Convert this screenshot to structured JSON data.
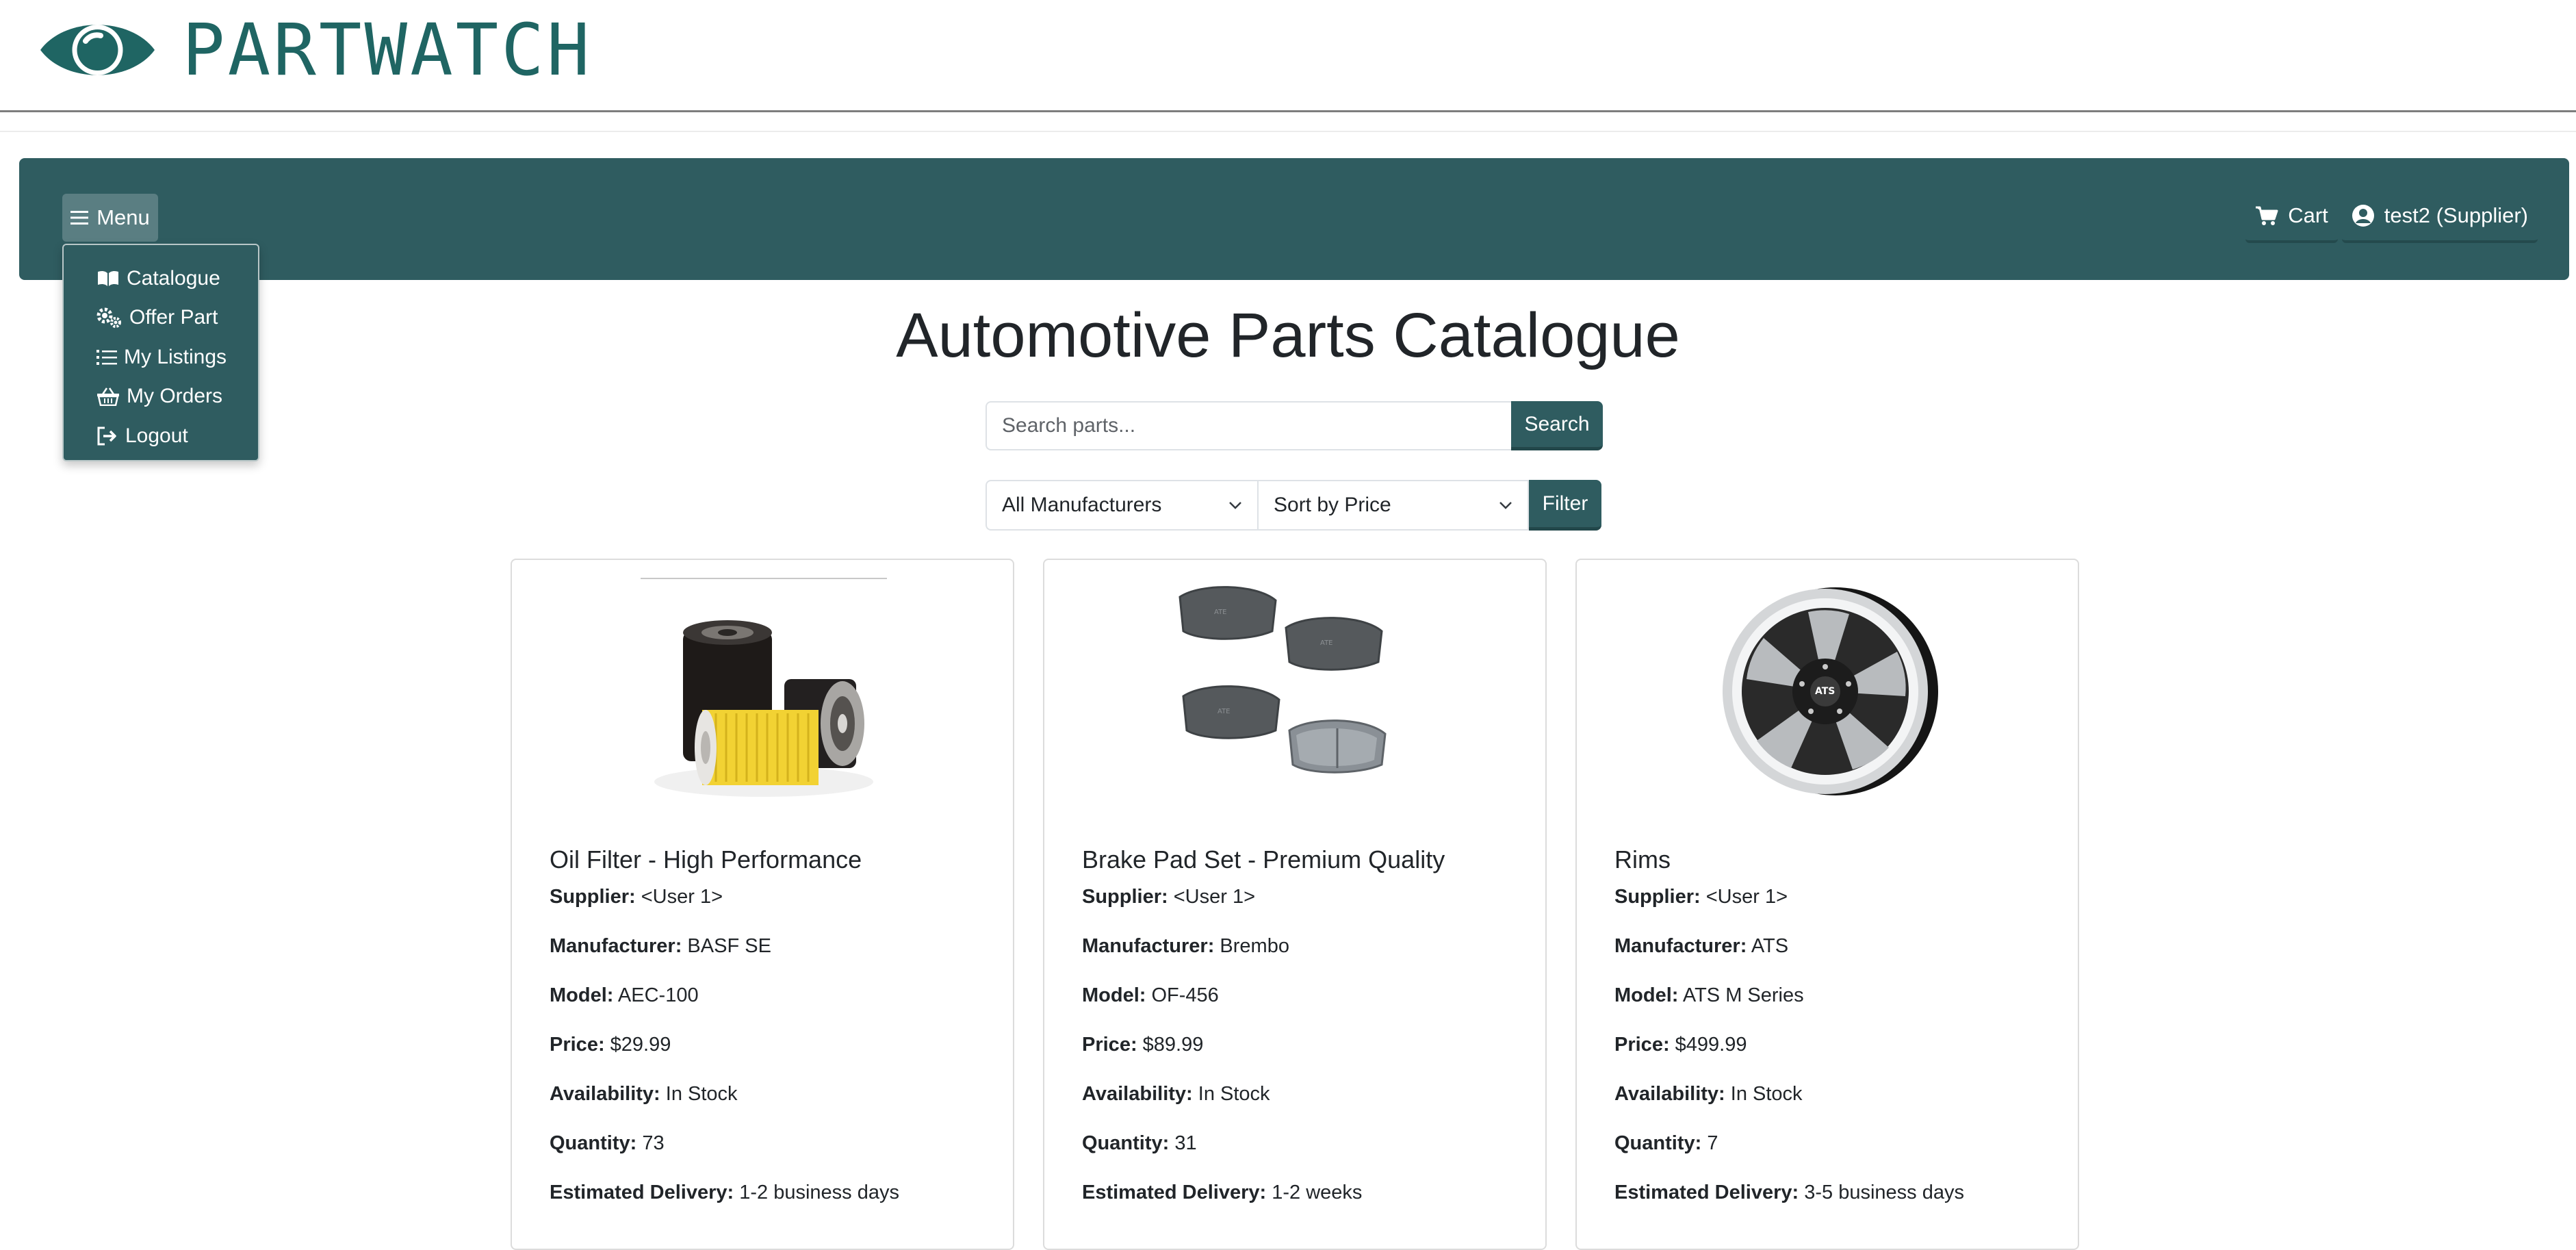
{
  "brand": {
    "name": "PARTWATCH",
    "logo_icon": "eye-icon"
  },
  "navbar": {
    "menu_label": "Menu",
    "cart_label": "Cart",
    "user_label": "test2 (Supplier)"
  },
  "menu": {
    "items": [
      {
        "label": "Catalogue",
        "icon": "book-icon"
      },
      {
        "label": "Offer Part",
        "icon": "gears-icon"
      },
      {
        "label": "My Listings",
        "icon": "list-icon"
      },
      {
        "label": "My Orders",
        "icon": "basket-icon"
      },
      {
        "label": "Logout",
        "icon": "logout-icon"
      }
    ]
  },
  "page": {
    "title": "Automotive Parts Catalogue"
  },
  "search": {
    "placeholder": "Search parts...",
    "value": "",
    "button_label": "Search"
  },
  "filters": {
    "manufacturer_selected": "All Manufacturers",
    "sort_selected": "Sort by Price",
    "button_label": "Filter"
  },
  "field_labels": {
    "supplier": "Supplier:",
    "manufacturer": "Manufacturer:",
    "model": "Model:",
    "price": "Price:",
    "availability": "Availability:",
    "quantity": "Quantity:",
    "delivery": "Estimated Delivery:"
  },
  "products": [
    {
      "title": "Oil Filter - High Performance",
      "image": "oil-filter-image",
      "supplier": "<User 1>",
      "manufacturer": "BASF SE",
      "model": "AEC-100",
      "price": "$29.99",
      "availability": "In Stock",
      "quantity": "73",
      "delivery": "1-2 business days"
    },
    {
      "title": "Brake Pad Set - Premium Quality",
      "image": "brake-pads-image",
      "supplier": "<User 1>",
      "manufacturer": "Brembo",
      "model": "OF-456",
      "price": "$89.99",
      "availability": "In Stock",
      "quantity": "31",
      "delivery": "1-2 weeks"
    },
    {
      "title": "Rims",
      "image": "rim-image",
      "supplier": "<User 1>",
      "manufacturer": "ATS",
      "model": "ATS M Series",
      "price": "$499.99",
      "availability": "In Stock",
      "quantity": "7",
      "delivery": "3-5 business days"
    }
  ],
  "colors": {
    "brand_teal": "#1f6563",
    "navbar_bg": "#2f5c60",
    "menu_button_bg": "#5a7e82"
  }
}
